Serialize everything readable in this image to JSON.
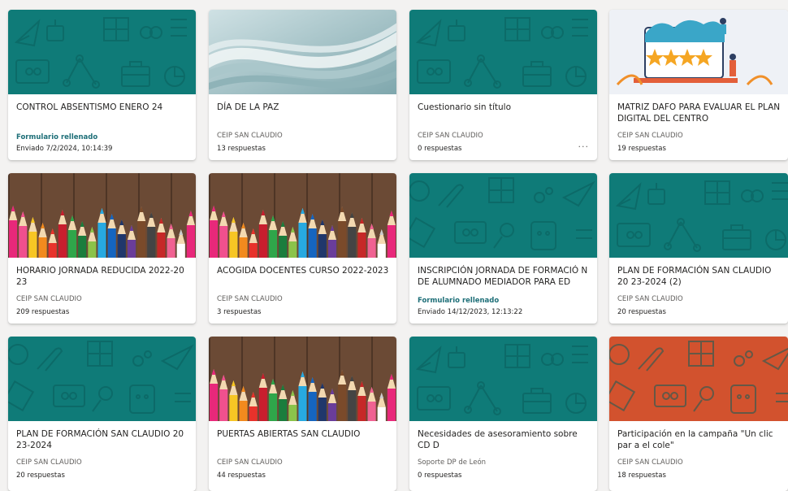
{
  "colors": {
    "teal": "#0f7b78",
    "orange": "#d2522e",
    "link": "#1e6f78"
  },
  "forms": [
    {
      "title": "CONTROL ABSENTISMO ENERO 24",
      "line1": "Formulario rellenado",
      "line2": "Enviado 7/2/2024, 10:14:39"
    },
    {
      "title": "DÍA DE LA PAZ",
      "line1": "CEIP SAN CLAUDIO",
      "line2": "13 respuestas"
    },
    {
      "title": "Cuestionario sin título",
      "line1": "CEIP SAN CLAUDIO",
      "line2": "0 respuestas",
      "more": "···"
    },
    {
      "title": "MATRIZ DAFO PARA EVALUAR EL PLAN DIGITAL DEL CENTRO",
      "line1": "CEIP SAN CLAUDIO",
      "line2": "19 respuestas"
    },
    {
      "title": "HORARIO JORNADA REDUCIDA 2022-20 23",
      "line1": "CEIP SAN CLAUDIO",
      "line2": "209 respuestas"
    },
    {
      "title": "ACOGIDA DOCENTES CURSO 2022-2023",
      "line1": "CEIP SAN CLAUDIO",
      "line2": "3 respuestas"
    },
    {
      "title": "INSCRIPCIÓN JORNADA DE FORMACIÓ N DE ALUMNADO MEDIADOR PARA ED",
      "line1": "Formulario rellenado",
      "line2": "Enviado 14/12/2023, 12:13:22"
    },
    {
      "title": "PLAN DE FORMACIÓN SAN CLAUDIO 20 23-2024 (2)",
      "line1": "CEIP SAN CLAUDIO",
      "line2": "20 respuestas"
    },
    {
      "title": "PLAN DE FORMACIÓN SAN CLAUDIO 20 23-2024",
      "line1": "CEIP SAN CLAUDIO",
      "line2": "20 respuestas"
    },
    {
      "title": "PUERTAS ABIERTAS SAN CLAUDIO",
      "line1": "CEIP SAN CLAUDIO",
      "line2": "44 respuestas"
    },
    {
      "title": "Necesidades de asesoramiento sobre CD D",
      "line1": "Soporte DP de León",
      "line2": "0 respuestas"
    },
    {
      "title": "Participación en la campaña \"Un clic par a el cole\"",
      "line1": "CEIP SAN CLAUDIO",
      "line2": "18 respuestas"
    }
  ]
}
